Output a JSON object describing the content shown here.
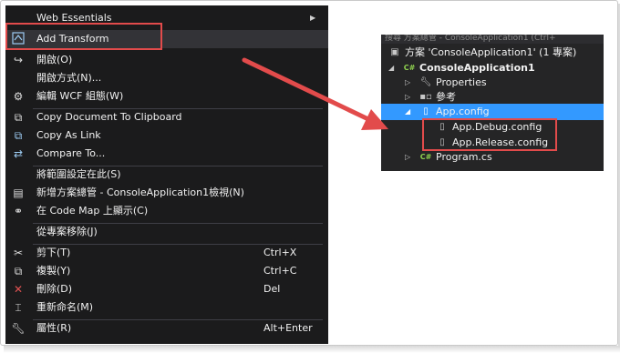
{
  "context_menu": {
    "items": [
      {
        "label": "Web Essentials",
        "icon": "none",
        "submenu": true
      },
      {
        "label": "Add Transform",
        "icon": "transform-icon"
      },
      {
        "label": "開啟(O)",
        "icon": "open-arrow-icon"
      },
      {
        "label": "開啟方式(N)...",
        "icon": "none"
      },
      {
        "label": "編輯 WCF 組態(W)",
        "icon": "wcf-gear-icon"
      },
      {
        "label": "Copy Document To Clipboard",
        "icon": "copy-document-icon"
      },
      {
        "label": "Copy As Link",
        "icon": "copy-link-icon"
      },
      {
        "label": "Compare To...",
        "icon": "compare-icon"
      },
      {
        "label": "將範圍設定在此(S)",
        "icon": "none"
      },
      {
        "label": "新增方案總管 - ConsoleApplication1檢視(N)",
        "icon": "new-view-icon"
      },
      {
        "label": "在 Code Map 上顯示(C)",
        "icon": "code-map-icon"
      },
      {
        "label": "從專案移除(J)",
        "icon": "none"
      },
      {
        "label": "剪下(T)",
        "shortcut": "Ctrl+X",
        "icon": "scissors-icon"
      },
      {
        "label": "複製(Y)",
        "shortcut": "Ctrl+C",
        "icon": "copy-icon"
      },
      {
        "label": "刪除(D)",
        "shortcut": "Del",
        "icon": "delete-x-icon"
      },
      {
        "label": "重新命名(M)",
        "icon": "rename-icon"
      },
      {
        "label": "屬性(R)",
        "shortcut": "Alt+Enter",
        "icon": "wrench-icon"
      }
    ]
  },
  "solution_explorer": {
    "title_fragment": "搜尋 方案總管 - ConsoleApplication1 (Ctrl+",
    "nodes": [
      {
        "label": "方案 'ConsoleApplication1' (1 專案)",
        "icon": "solution-icon"
      },
      {
        "label": "ConsoleApplication1",
        "icon": "csharp-project-icon"
      },
      {
        "label": "Properties",
        "icon": "wrench-icon"
      },
      {
        "label": "參考",
        "icon": "references-icon"
      },
      {
        "label": "App.config",
        "icon": "config-file-icon",
        "selected": true
      },
      {
        "label": "App.Debug.config",
        "icon": "config-file-icon"
      },
      {
        "label": "App.Release.config",
        "icon": "config-file-icon"
      },
      {
        "label": "Program.cs",
        "icon": "csharp-file-icon"
      }
    ]
  },
  "colors": {
    "menu_background": "#1b1b1c",
    "highlight_box": "#e24b4b",
    "selection": "#3399ff",
    "arrow": "#e24b4b"
  }
}
